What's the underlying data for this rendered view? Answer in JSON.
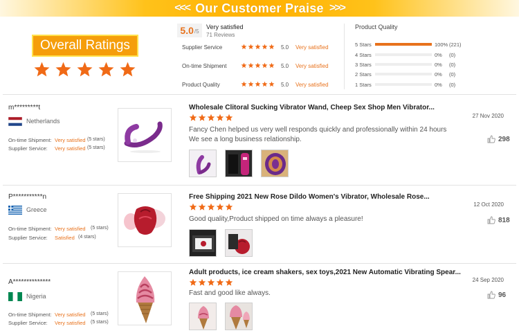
{
  "banner": {
    "title": "Our Customer Praise",
    "left_chevrons": "<<<",
    "right_chevrons": ">>>"
  },
  "summary": {
    "overall_label": "Overall Ratings",
    "overall_stars": 5,
    "score": "5.0",
    "score_suffix": "/5",
    "score_text": "Very satisfied",
    "reviews": "71 Reviews",
    "metrics": [
      {
        "label": "Supplier Service",
        "score": "5.0",
        "text": "Very satisfied"
      },
      {
        "label": "On-time Shipment",
        "score": "5.0",
        "text": "Very satisfied"
      },
      {
        "label": "Product Quality",
        "score": "5.0",
        "text": "Very satisfied"
      }
    ],
    "product_quality_title": "Product Quality",
    "breakdown": [
      {
        "label": "5 Stars",
        "pct": "100%",
        "count": "(221)",
        "fraction": 1.0
      },
      {
        "label": "4 Stars",
        "pct": "0%",
        "count": "(0)",
        "fraction": 0
      },
      {
        "label": "3 Stars",
        "pct": "0%",
        "count": "(0)",
        "fraction": 0
      },
      {
        "label": "2 Stars",
        "pct": "0%",
        "count": "(0)",
        "fraction": 0
      },
      {
        "label": "1 Stars",
        "pct": "0%",
        "count": "(0)",
        "fraction": 0
      }
    ]
  },
  "reviews": [
    {
      "name": "m*********t",
      "country": "Netherlands",
      "shipment_label": "On-time Shipment:",
      "shipment_value": "Very satisfied",
      "shipment_stars": "(5 stars)",
      "supplier_label": "Supplier Service:",
      "supplier_value": "Very satisfied",
      "supplier_stars": "(5 stars)",
      "title": "Wholesale Clitoral Sucking Vibrator Wand, Cheep Sex Shop Men Vibrator...",
      "stars": 5,
      "body_lines": [
        "Fancy Chen helped us very well responds quickly and professionally within 24 hours",
        "We see a long business relationship."
      ],
      "date": "27 Nov 2020",
      "likes": "298"
    },
    {
      "name": "P***********n",
      "country": "Greece",
      "shipment_label": "On-time Shipment:",
      "shipment_value": "Very satisfied",
      "shipment_stars": "(5 stars)",
      "supplier_label": "Supplier Service:",
      "supplier_value": "Satisfied",
      "supplier_stars": "(4 stars)",
      "title": "Free Shipping 2021 New Rose Dildo Women's Vibrator, Wholesale Rose...",
      "stars": 5,
      "body_lines": [
        "Good quality,Product shipped on time always a pleasure!"
      ],
      "date": "12 Oct 2020",
      "likes": "818"
    },
    {
      "name": "A**************",
      "country": "Nigeria",
      "shipment_label": "On-time Shipment:",
      "shipment_value": "Very satisfied",
      "shipment_stars": "(5 stars)",
      "supplier_label": "Supplier Service:",
      "supplier_value": "Very satisfied",
      "supplier_stars": "(5 stars)",
      "title": "Adult products, ice cream shakers, sex toys,2021 New Automatic Vibrating Spear...",
      "stars": 5,
      "body_lines": [
        "Fast and good like always."
      ],
      "date": "24 Sep 2020",
      "likes": "96"
    }
  ],
  "colors": {
    "accent": "#e8721c",
    "gold": "#ffb000",
    "star": "#f06a16"
  }
}
